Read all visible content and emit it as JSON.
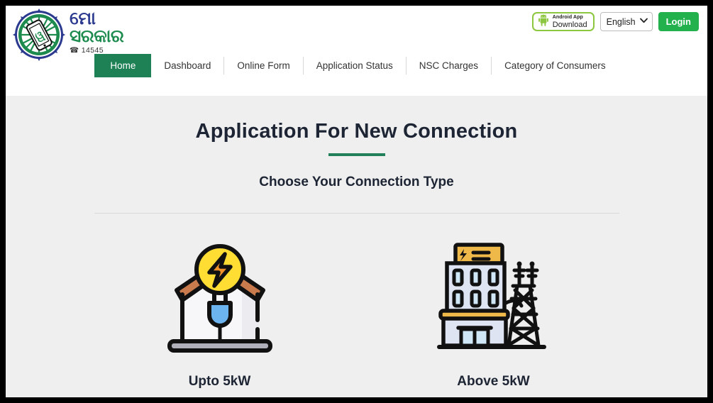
{
  "brand": {
    "line1": "ମୋ",
    "line2": "ସରକାର",
    "phone": "☎ 14545",
    "logo_icon": "mo-sarkar-chakra-mobile-logo"
  },
  "header": {
    "android_button": {
      "title": "Android App",
      "subtitle": "Download",
      "icon": "android-robot-icon",
      "border_color": "#8dc63f"
    },
    "language": {
      "selected": "English",
      "icon": "chevron-down-icon",
      "options": [
        "English"
      ]
    },
    "login_label": "Login",
    "login_color": "#22b14c"
  },
  "nav": {
    "active_color": "#1e8055",
    "items": [
      {
        "label": "Home",
        "active": true
      },
      {
        "label": "Dashboard",
        "active": false
      },
      {
        "label": "Online Form",
        "active": false
      },
      {
        "label": "Application Status",
        "active": false
      },
      {
        "label": "NSC Charges",
        "active": false
      },
      {
        "label": "Category of Consumers",
        "active": false
      }
    ]
  },
  "main": {
    "title": "Application For New Connection",
    "title_underline_color": "#218059",
    "subtitle": "Choose Your Connection Type",
    "choices": [
      {
        "label": "Upto 5kW",
        "icon": "house-with-electric-plug-icon",
        "colors": {
          "roof": "#c97b4e",
          "bolt_circle": "#ffdd33",
          "bolt": "#f0922b",
          "plug": "#6cb4f0",
          "base": "#b0b0bb"
        }
      },
      {
        "label": "Above 5kW",
        "icon": "industrial-building-with-power-pylon-icon",
        "colors": {
          "sign": "#efb94a",
          "wall": "#dfe4f2",
          "window": "#cfe7f7",
          "band": "#efb94a"
        }
      }
    ]
  }
}
